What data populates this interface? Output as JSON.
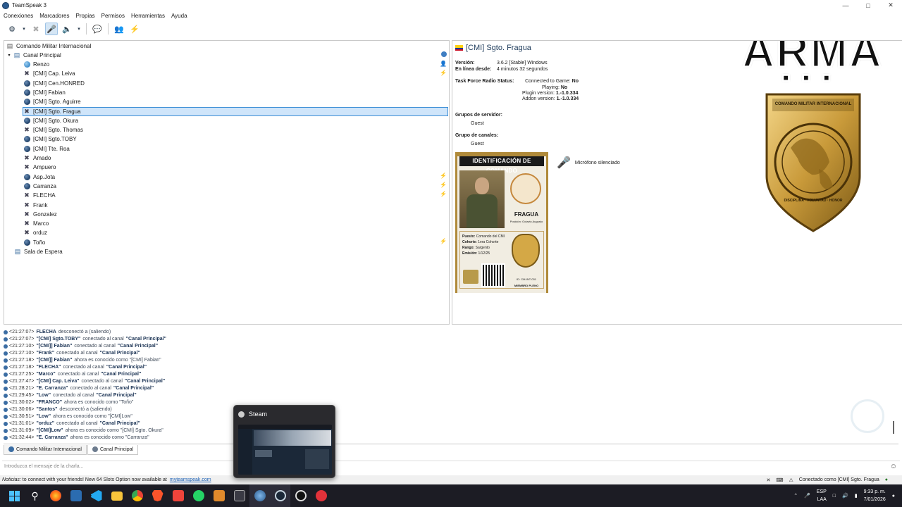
{
  "window": {
    "title": "TeamSpeak 3"
  },
  "menu": [
    "Conexiones",
    "Marcadores",
    "Propias",
    "Permisos",
    "Herramientas",
    "Ayuda"
  ],
  "tree": {
    "server": "Comando Militar Internacional",
    "channel": "Canal Principal",
    "users": [
      {
        "name": "Renzo",
        "status": "green"
      },
      {
        "name": "[CMI] Cap. Leiva",
        "status": "mic"
      },
      {
        "name": "[CMI] Cen.HONRED",
        "status": "ball"
      },
      {
        "name": "[CMI] Fabian",
        "status": "ball"
      },
      {
        "name": "[CMI] Sgto. Aguirre",
        "status": "ball"
      },
      {
        "name": "[CMI] Sgto. Fragua",
        "status": "mic",
        "selected": true
      },
      {
        "name": "[CMI] Sgto. Okura",
        "status": "ball"
      },
      {
        "name": "[CMI] Sgto. Thomas",
        "status": "mic"
      },
      {
        "name": "[CMI] Sgto.TOBY",
        "status": "ball"
      },
      {
        "name": "[CMI] Tte. Roa",
        "status": "ball"
      },
      {
        "name": "Amado",
        "status": "mic"
      },
      {
        "name": "Ampuero",
        "status": "mic"
      },
      {
        "name": "Asp.Jota",
        "status": "ball"
      },
      {
        "name": "Carranza",
        "status": "ball"
      },
      {
        "name": "FLECHA",
        "status": "mic"
      },
      {
        "name": "Frank",
        "status": "mic"
      },
      {
        "name": "Gonzalez",
        "status": "mic"
      },
      {
        "name": "Marco",
        "status": "mic"
      },
      {
        "name": "orduz",
        "status": "mic"
      },
      {
        "name": "Toño",
        "status": "ball"
      }
    ],
    "waiting_room": "Sala de Espera"
  },
  "info": {
    "name": "[CMI] Sgto. Fragua",
    "version_label": "Versión:",
    "version_value": "3.6.2 [Stable] Windows",
    "online_label": "En línea desde:",
    "online_value": "4 minutos 32 segundos",
    "tfr_label": "Task Force Radio Status:",
    "tfr_connected_label": "Connected to Game:",
    "tfr_connected_value": "No",
    "tfr_playing_label": "Playing:",
    "tfr_playing_value": "No",
    "tfr_plugin_label": "Plugin version:",
    "tfr_plugin_value": "1.-1.0.334",
    "tfr_addon_label": "Addon version:",
    "tfr_addon_value": "1.-1.0.334",
    "server_groups_label": "Grupos de servidor:",
    "server_groups_value": "Guest",
    "channel_groups_label": "Grupo de canales:",
    "channel_groups_value": "Guest",
    "mic_status": "Micrófono silenciado",
    "card": {
      "header": "IDENTIFICACIÓN DE COMANDO",
      "surname": "FRAGUA",
      "position": "Posición: Octavio Augusto",
      "puesto_label": "Puesto:",
      "puesto_value": "Comando del CMI",
      "cohorte_label": "Cohorte:",
      "cohorte_value": "1era Cohorte",
      "rango_label": "Rango:",
      "rango_value": "Sargento",
      "emision_label": "Emisión:",
      "emision_value": "1/12/25",
      "id": "ID: CM-INT-031",
      "member": "MIEMBRO PLENO"
    },
    "logo_text": "ARMA",
    "badge_top": "COMANDO MILITAR INTERNACIONAL",
    "badge_bottom": "DISCIPLINA · VOLUNTAD · HONOR"
  },
  "log": [
    {
      "time": "<21:27:07>",
      "name": "FLECHA",
      "msg": "desconectó a (saliendo)",
      "channel": ""
    },
    {
      "time": "<21:27:07>",
      "name": "\"[CMI] Sgto.TOBY\"",
      "msg": "conectado al canal",
      "channel": "\"Canal Principal\""
    },
    {
      "time": "<21:27:10>",
      "name": "\"[CMI]] Fabian\"",
      "msg": "conectado al canal",
      "channel": "\"Canal Principal\""
    },
    {
      "time": "<21:27:10>",
      "name": "\"Frank\"",
      "msg": "conectado al canal",
      "channel": "\"Canal Principal\""
    },
    {
      "time": "<21:27:18>",
      "name": "\"[CMI]] Fabian\"",
      "msg": "ahora es conocido como \"[CMI] Fabian\"",
      "channel": ""
    },
    {
      "time": "<21:27:18>",
      "name": "\"FLECHA\"",
      "msg": "conectado al canal",
      "channel": "\"Canal Principal\""
    },
    {
      "time": "<21:27:25>",
      "name": "\"Marco\"",
      "msg": "conectado al canal",
      "channel": "\"Canal Principal\""
    },
    {
      "time": "<21:27:47>",
      "name": "\"[CMI] Cap. Leiva\"",
      "msg": "conectado al canal",
      "channel": "\"Canal Principal\""
    },
    {
      "time": "<21:28:21>",
      "name": "\"E. Carranza\"",
      "msg": "conectado al canal",
      "channel": "\"Canal Principal\""
    },
    {
      "time": "<21:29:45>",
      "name": "\"Low\"",
      "msg": "conectado al canal",
      "channel": "\"Canal Principal\""
    },
    {
      "time": "<21:30:02>",
      "name": "\"FRANCO\"",
      "msg": "ahora es conocido como \"Toño\"",
      "channel": ""
    },
    {
      "time": "<21:30:06>",
      "name": "\"Santos\"",
      "msg": "desconectó a (saliendo)",
      "channel": ""
    },
    {
      "time": "<21:30:51>",
      "name": "\"Low\"",
      "msg": "ahora es conocido como \"[CMI]Low\"",
      "channel": ""
    },
    {
      "time": "<21:31:01>",
      "name": "\"orduz\"",
      "msg": "conectado al canal",
      "channel": "\"Canal Principal\""
    },
    {
      "time": "<21:31:09>",
      "name": "\"[CMI]Low\"",
      "msg": "ahora es conocido como \"[CMI] Sgto. Okura\"",
      "channel": ""
    },
    {
      "time": "<21:32:44>",
      "name": "\"E. Carranza\"",
      "msg": "ahora es conocido como \"Carranza\"",
      "channel": ""
    }
  ],
  "tabs": [
    "Comando Militar Internacional",
    "Canal Principal"
  ],
  "chat_placeholder": "Introduzca el mensaje de la charla...",
  "status": {
    "notice_label": "Noticias:",
    "notice_text": "to connect with your friends! New 64 Slots Option now available at",
    "notice_link": "myteamspeak.com",
    "connected": "Conectado como [CMI] Sgto. Fragua"
  },
  "taskbar_popup": {
    "title": "Steam"
  },
  "tray": {
    "lang1": "ESP",
    "lang2": "LAA",
    "time": "9:33 p. m.",
    "date": "7/01/2026"
  }
}
